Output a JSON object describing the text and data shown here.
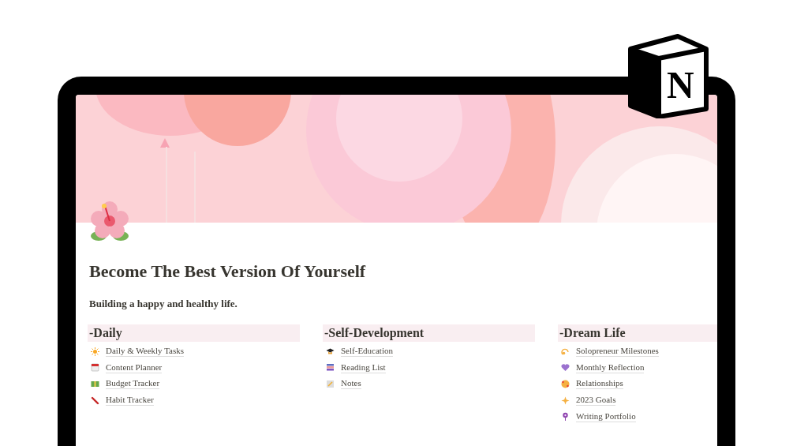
{
  "logo": {
    "letter": "N"
  },
  "page": {
    "title": "Become The Best Version Of Yourself",
    "subtitle": "Building a happy and healthy life."
  },
  "columns": [
    {
      "heading": "-Daily",
      "links": [
        "Daily & Weekly Tasks",
        "Content Planner",
        "Budget Tracker",
        "Habit Tracker"
      ]
    },
    {
      "heading": "-Self-Development",
      "links": [
        "Self-Education",
        "Reading List",
        "Notes"
      ]
    },
    {
      "heading": "-Dream Life",
      "links": [
        "Solopreneur Milestones",
        "Monthly Reflection",
        "Relationships",
        "2023 Goals",
        "Writing Portfolio"
      ]
    }
  ]
}
